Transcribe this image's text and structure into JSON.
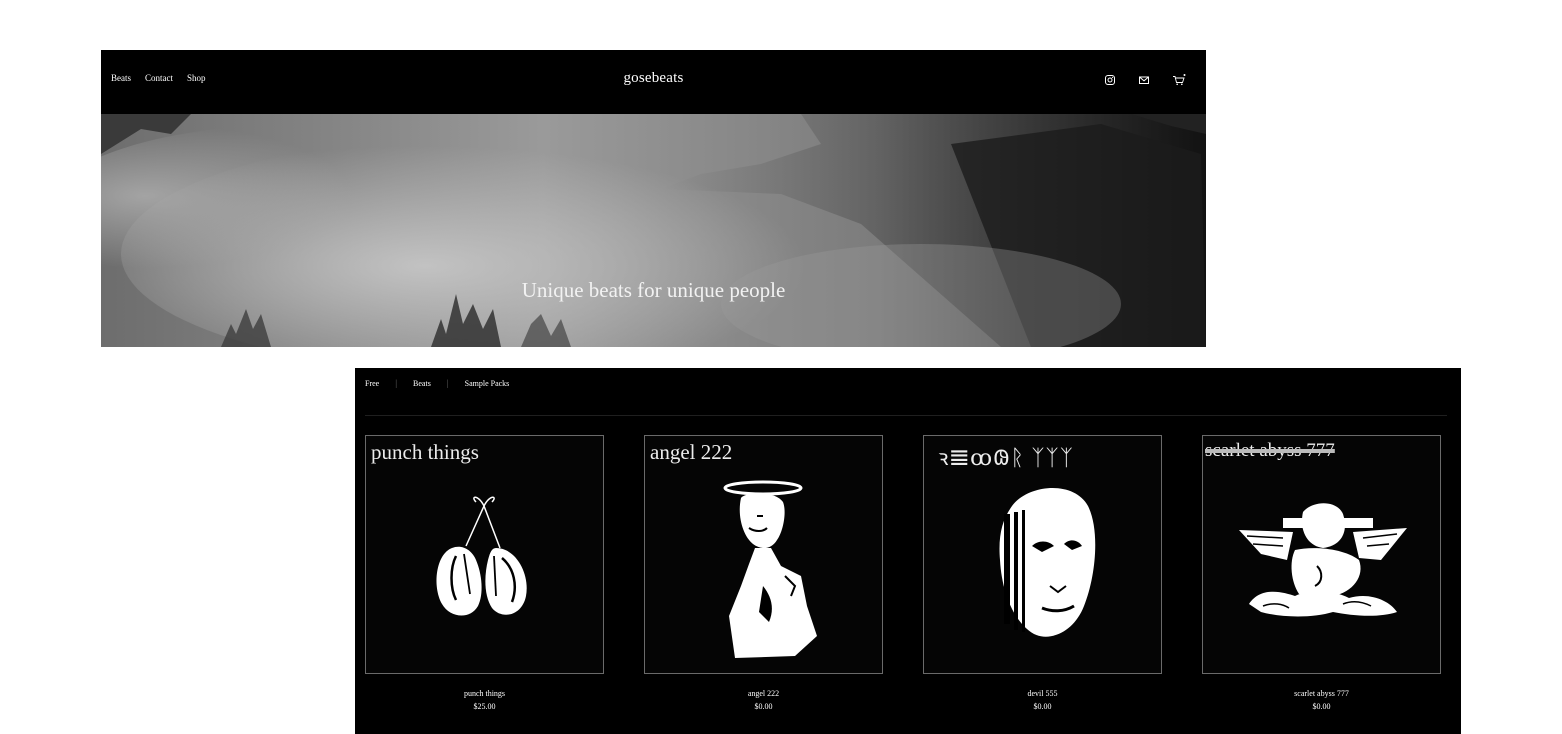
{
  "header": {
    "nav": [
      "Beats",
      "Contact",
      "Shop"
    ],
    "brand": "gosebeats",
    "icons": [
      "instagram-icon",
      "mail-icon",
      "cart-icon"
    ]
  },
  "hero": {
    "tagline": "Unique beats for unique people"
  },
  "shop": {
    "filters": [
      "Free",
      "Beats",
      "Sample Packs"
    ],
    "products": [
      {
        "cover_title": "punch things",
        "name": "punch things",
        "price": "$25.00",
        "art": "boxing-gloves"
      },
      {
        "cover_title": "angel 222",
        "name": "angel 222",
        "price": "$0.00",
        "art": "statue-with-halo"
      },
      {
        "cover_title": "ꝛ𝌆ꝏ𐐘ᚱ ᛉᛉᛉ",
        "name": "devil 555",
        "price": "$0.00",
        "art": "white-mask"
      },
      {
        "cover_title": "scarlet abyss 777",
        "name": "scarlet abyss 777",
        "price": "$0.00",
        "art": "cherub-on-clouds"
      }
    ]
  },
  "colors": {
    "background": "#000000",
    "text": "#ffffff",
    "page": "#ffffff"
  }
}
